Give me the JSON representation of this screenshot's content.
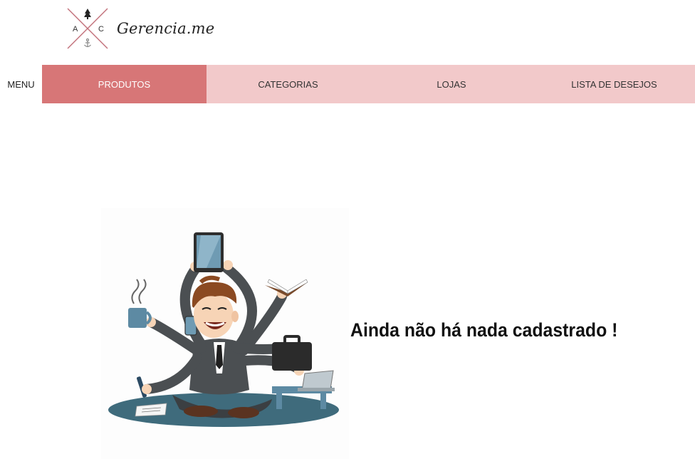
{
  "brand": {
    "name": "Gerencia.me",
    "mark_letters": {
      "left": "A",
      "right": "C"
    },
    "mark_line_color": "#c2707a"
  },
  "nav": {
    "menu_label": "MENU",
    "items": [
      {
        "label": "PRODUTOS",
        "active": true
      },
      {
        "label": "CATEGORIAS",
        "active": false
      },
      {
        "label": "LOJAS",
        "active": false
      },
      {
        "label": "LISTA DE DESEJOS",
        "active": false
      }
    ],
    "colors": {
      "active": "#d77677",
      "inactive": "#f2c9ca"
    }
  },
  "empty_state": {
    "message": "Ainda não há nada cadastrado !",
    "illustration": "multitasking-businessman-illustration"
  }
}
